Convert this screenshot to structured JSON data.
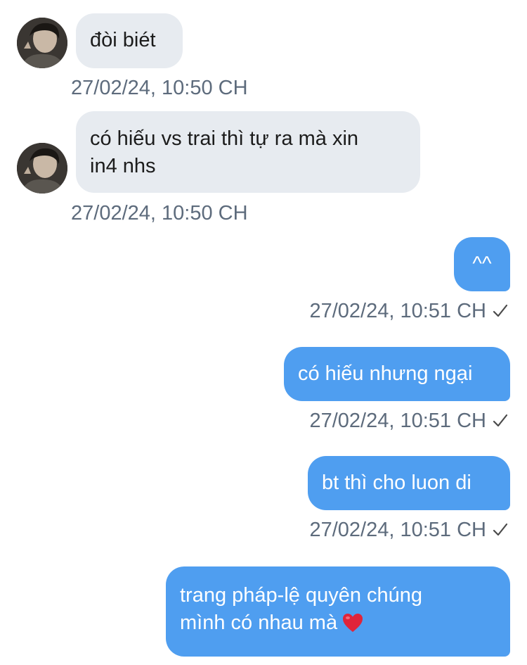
{
  "messages": [
    {
      "dir": "in",
      "lines": [
        "đòi biét"
      ],
      "time": "27/02/24, 10:50 CH"
    },
    {
      "dir": "in",
      "lines": [
        "có hiếu vs trai thì tự ra mà xin",
        "in4 nhs"
      ],
      "time": "27/02/24, 10:50 CH"
    },
    {
      "dir": "out",
      "lines": [
        "^^"
      ],
      "time": "27/02/24, 10:51 CH",
      "status_icon": "check-icon"
    },
    {
      "dir": "out",
      "lines": [
        "có hiếu nhưng ngại"
      ],
      "time": "27/02/24, 10:51 CH",
      "status_icon": "check-icon"
    },
    {
      "dir": "out",
      "lines": [
        "bt thì cho luon di"
      ],
      "time": "27/02/24, 10:51 CH",
      "status_icon": "check-icon"
    },
    {
      "dir": "out",
      "lines": [
        "trang pháp-lệ quyên chúng",
        "mình có nhau mà"
      ],
      "emoji": "heart-icon"
    }
  ],
  "colors": {
    "incoming_bubble": "#e7ebf0",
    "outgoing_bubble": "#4f9ef0",
    "timestamp": "#5d6b7c",
    "heart": "#e0243a"
  }
}
